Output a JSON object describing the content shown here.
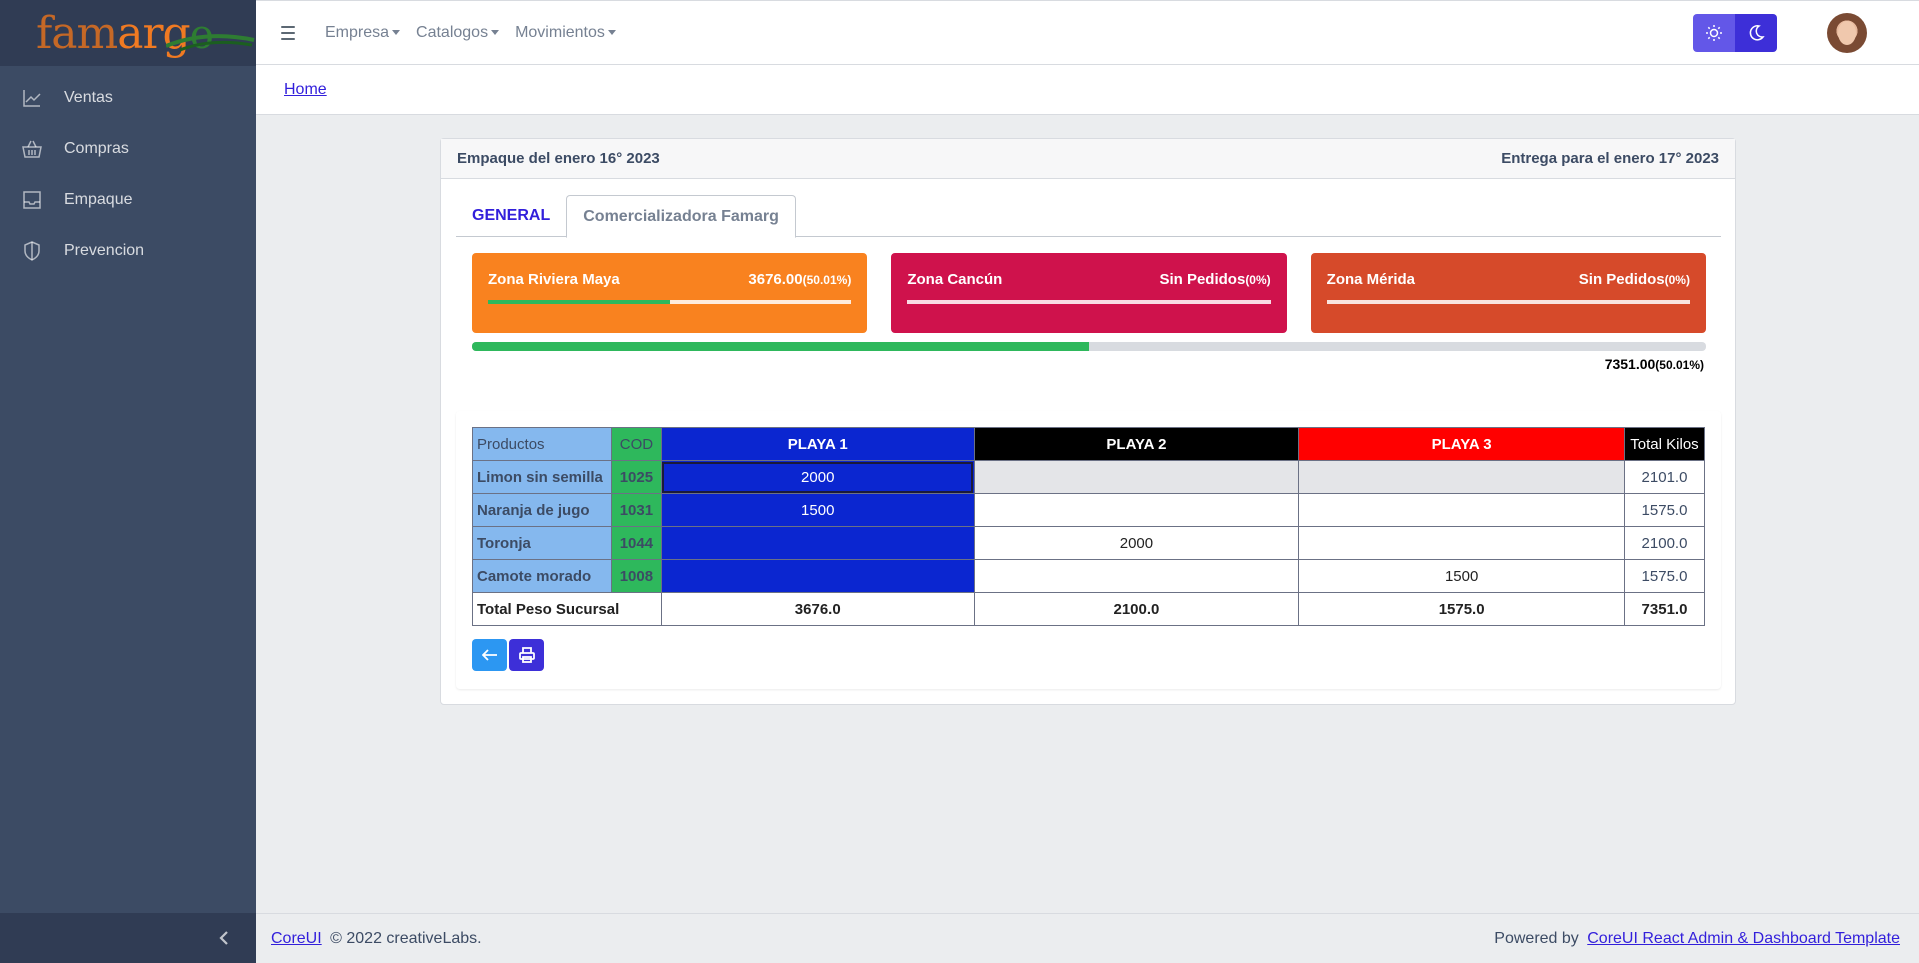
{
  "brand": {
    "logo_text_1": "fam",
    "logo_text_2": "arg",
    "logo_text_3": "o"
  },
  "sidebar": {
    "items": [
      {
        "label": "Ventas",
        "icon": "chart-line-icon"
      },
      {
        "label": "Compras",
        "icon": "basket-icon"
      },
      {
        "label": "Empaque",
        "icon": "inbox-icon"
      },
      {
        "label": "Prevencion",
        "icon": "shield-icon"
      }
    ]
  },
  "header": {
    "menu": [
      "Empresa",
      "Catalogos",
      "Movimientos"
    ],
    "breadcrumb": "Home"
  },
  "card": {
    "title_left": "Empaque del enero 16° 2023",
    "title_right": "Entrega para el enero 17° 2023",
    "tabs": [
      "GENERAL",
      "Comercializadora Famarg"
    ]
  },
  "zones": [
    {
      "name": "Zona Riviera Maya",
      "value": "3676.00",
      "pct": "(50.01%)",
      "color": "#f9821f",
      "fill_fraction": 0.5001
    },
    {
      "name": "Zona Cancún",
      "value": "Sin Pedidos",
      "pct": "(0%)",
      "color": "#cf124c",
      "fill_fraction": 0
    },
    {
      "name": "Zona Mérida",
      "value": "Sin Pedidos",
      "pct": "(0%)",
      "color": "#d64a2a",
      "fill_fraction": 0
    }
  ],
  "total": {
    "value": "7351.00",
    "pct": "(50.01%)",
    "fill_fraction": 0.5001
  },
  "table": {
    "headers": [
      "Productos",
      "COD",
      "PLAYA 1",
      "PLAYA 2",
      "PLAYA 3",
      "Total Kilos"
    ],
    "rows": [
      {
        "product": "Limon sin semilla",
        "cod": "1025",
        "p1": "2000",
        "p2": "",
        "p3": "",
        "total": "2101.0"
      },
      {
        "product": "Naranja de jugo",
        "cod": "1031",
        "p1": "1500",
        "p2": "",
        "p3": "",
        "total": "1575.0"
      },
      {
        "product": "Toronja",
        "cod": "1044",
        "p1": "",
        "p2": "2000",
        "p3": "",
        "total": "2100.0"
      },
      {
        "product": "Camote morado",
        "cod": "1008",
        "p1": "",
        "p2": "",
        "p3": "1500",
        "total": "1575.0"
      }
    ],
    "footer": {
      "label": "Total Peso Sucursal",
      "p1": "3676.0",
      "p2": "2100.0",
      "p3": "1575.0",
      "total": "7351.0"
    }
  },
  "footer": {
    "left_link": "CoreUI",
    "left_text": "© 2022 creativeLabs.",
    "right_text": "Powered by",
    "right_link": "CoreUI React Admin & Dashboard Template"
  }
}
